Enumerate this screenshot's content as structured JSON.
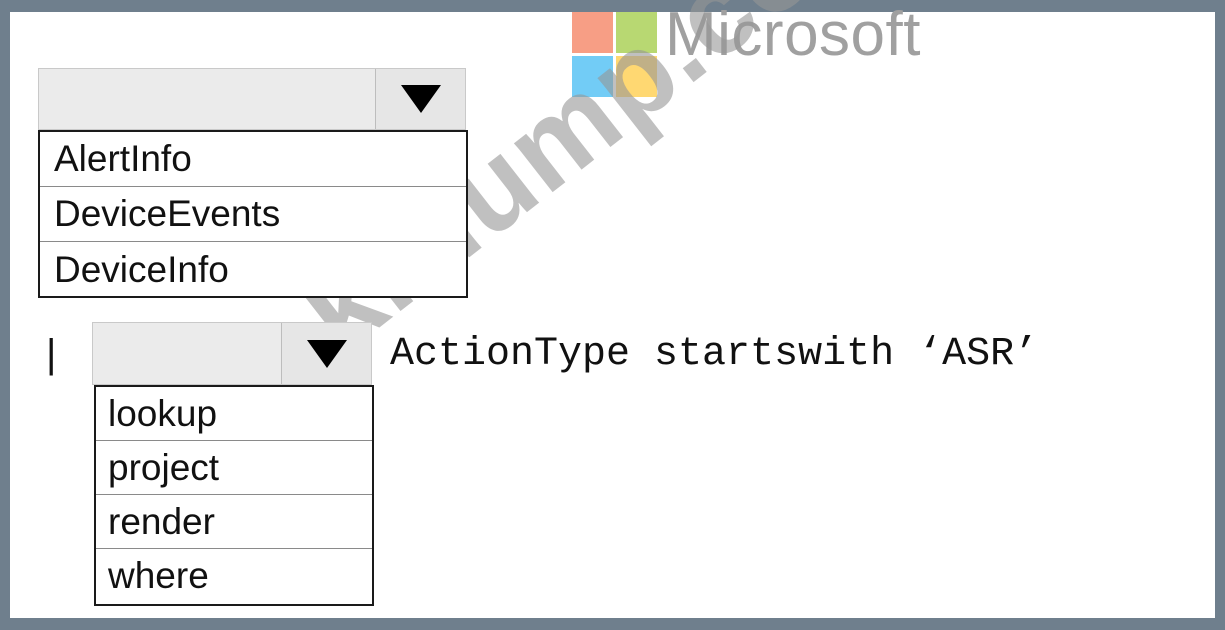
{
  "logo": {
    "text": "Microsoft",
    "colors": [
      "#f25022",
      "#7fba00",
      "#00a4ef",
      "#ffb900"
    ]
  },
  "watermark": "krdump.com",
  "dropdown1": {
    "selected": "",
    "options": [
      "AlertInfo",
      "DeviceEvents",
      "DeviceInfo"
    ]
  },
  "line2": {
    "pipe": "|",
    "dropdown2": {
      "selected": "",
      "options": [
        "lookup",
        "project",
        "render",
        "where"
      ]
    },
    "code": "ActionType startswith ‘ASR’"
  }
}
